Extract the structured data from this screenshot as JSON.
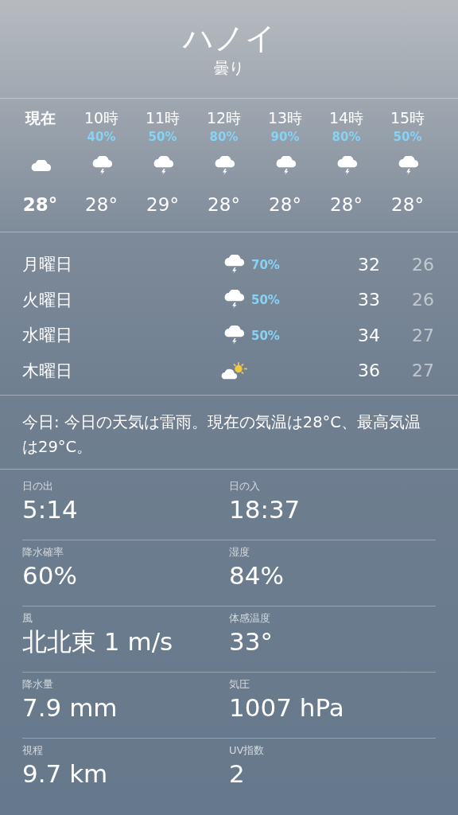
{
  "location": {
    "city": "ハノイ",
    "condition": "曇り"
  },
  "hourly": [
    {
      "time": "現在",
      "now": true,
      "kind": "cloudy",
      "temp": "28°"
    },
    {
      "time": "10時",
      "now": false,
      "pop": "40%",
      "kind": "thunder",
      "temp": "28°"
    },
    {
      "time": "11時",
      "now": false,
      "pop": "50%",
      "kind": "thunder",
      "temp": "29°"
    },
    {
      "time": "12時",
      "now": false,
      "pop": "80%",
      "kind": "thunder",
      "temp": "28°"
    },
    {
      "time": "13時",
      "now": false,
      "pop": "90%",
      "kind": "thunder",
      "temp": "28°"
    },
    {
      "time": "14時",
      "now": false,
      "pop": "80%",
      "kind": "thunder",
      "temp": "28°"
    },
    {
      "time": "15時",
      "now": false,
      "pop": "50%",
      "kind": "thunder",
      "temp": "28°"
    }
  ],
  "daily": [
    {
      "day": "月曜日",
      "kind": "thunder",
      "pop": "70%",
      "high": "32",
      "low": "26"
    },
    {
      "day": "火曜日",
      "kind": "thunder",
      "pop": "50%",
      "high": "33",
      "low": "26"
    },
    {
      "day": "水曜日",
      "kind": "thunder",
      "pop": "50%",
      "high": "34",
      "low": "27"
    },
    {
      "day": "木曜日",
      "kind": "partly_sunny",
      "high": "36",
      "low": "27"
    }
  ],
  "summary": "今日: 今日の天気は雷雨。現在の気温は28°C、最高気温は29°C。",
  "details": [
    [
      {
        "label": "日の出",
        "value": "5:14"
      },
      {
        "label": "日の入",
        "value": "18:37"
      }
    ],
    [
      {
        "label": "降水確率",
        "value": "60%"
      },
      {
        "label": "湿度",
        "value": "84%"
      }
    ],
    [
      {
        "label": "風",
        "value": "北北東 1 m/s"
      },
      {
        "label": "体感温度",
        "value": "33°"
      }
    ],
    [
      {
        "label": "降水量",
        "value": "7.9 mm"
      },
      {
        "label": "気圧",
        "value": "1007 hPa"
      }
    ],
    [
      {
        "label": "視程",
        "value": "9.7 km"
      },
      {
        "label": "UV指数",
        "value": "2"
      }
    ]
  ]
}
